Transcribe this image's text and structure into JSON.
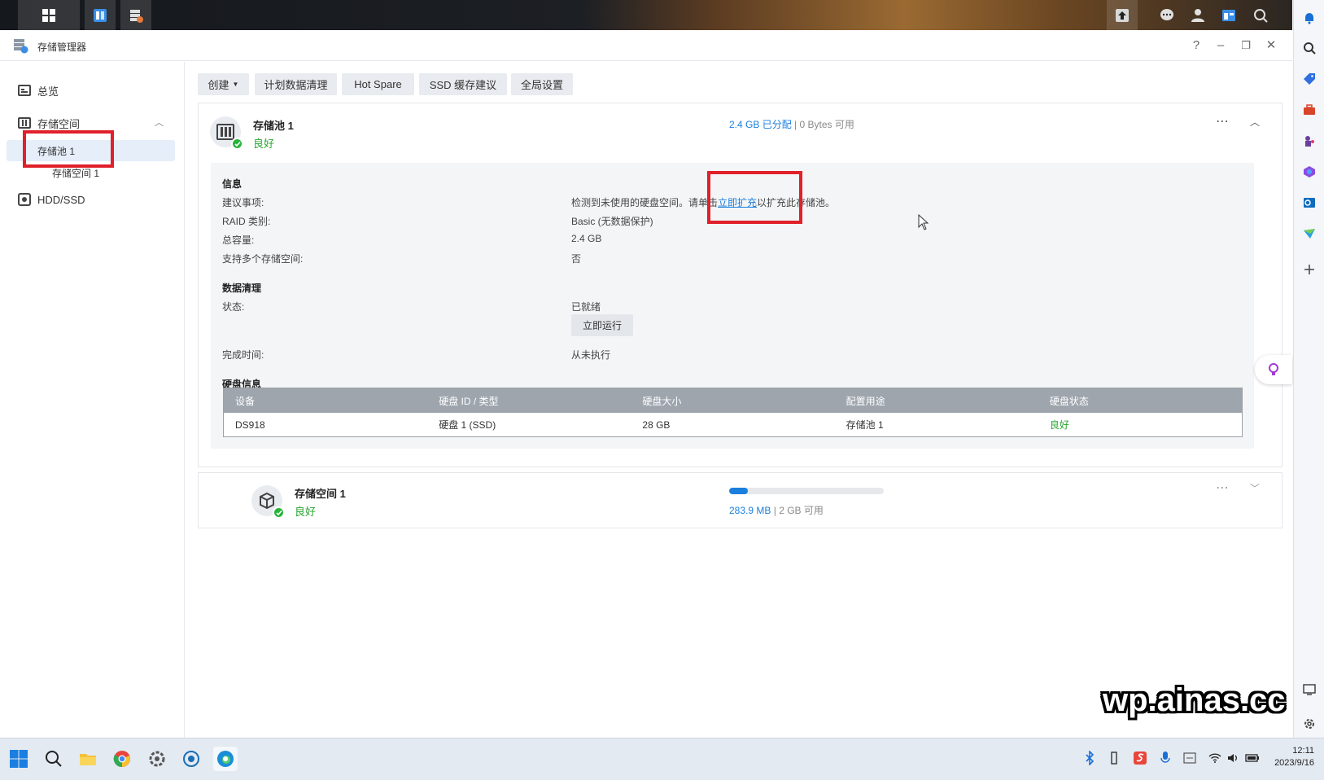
{
  "app": {
    "title": "存储管理器",
    "help": "?"
  },
  "sidebar": {
    "items": [
      {
        "label": "总览"
      },
      {
        "label": "存储空间"
      },
      {
        "label": "存储池 1"
      },
      {
        "label": "存储空间 1"
      },
      {
        "label": "HDD/SSD"
      }
    ]
  },
  "toolbar": {
    "create": "创建",
    "scrub": "计划数据清理",
    "hotspare": "Hot Spare",
    "ssd": "SSD 缓存建议",
    "global": "全局设置"
  },
  "pool": {
    "name": "存储池 1",
    "status": "良好",
    "allocated": "2.4 GB 已分配",
    "sep": "|",
    "available": "0 Bytes 可用",
    "info_title": "信息",
    "info": [
      {
        "label": "建议事项:",
        "value_pre": "检测到未使用的硬盘空间。请单击",
        "link": "立即扩充",
        "value_post": "以扩充此存储池。"
      },
      {
        "label": "RAID 类别:",
        "value": "Basic (无数据保护)"
      },
      {
        "label": "总容量:",
        "value": "2.4 GB"
      },
      {
        "label": "支持多个存储空间:",
        "value": "否"
      }
    ],
    "scrub_title": "数据清理",
    "scrub_status_label": "状态:",
    "scrub_status_value": "已就绪",
    "scrub_run_button": "立即运行",
    "scrub_done_label": "完成时间:",
    "scrub_done_value": "从未执行",
    "disk_title": "硬盘信息",
    "disk_headers": [
      "设备",
      "硬盘 ID / 类型",
      "硬盘大小",
      "配置用途",
      "硬盘状态"
    ],
    "disk_row": [
      "DS918",
      "硬盘 1 (SSD)",
      "28 GB",
      "存储池 1",
      "良好"
    ]
  },
  "volume": {
    "name": "存储空间 1",
    "status": "良好",
    "used": "283.9 MB",
    "sep": "|",
    "available": "2 GB 可用",
    "usage_fraction": 0.12
  },
  "taskbar": {
    "time": "12:11",
    "date": "2023/9/16"
  },
  "watermark": "wp.ainas.cc",
  "colors": {
    "accent": "#1a7fdd",
    "good": "#2aa531",
    "highlight": "#e0202a"
  }
}
